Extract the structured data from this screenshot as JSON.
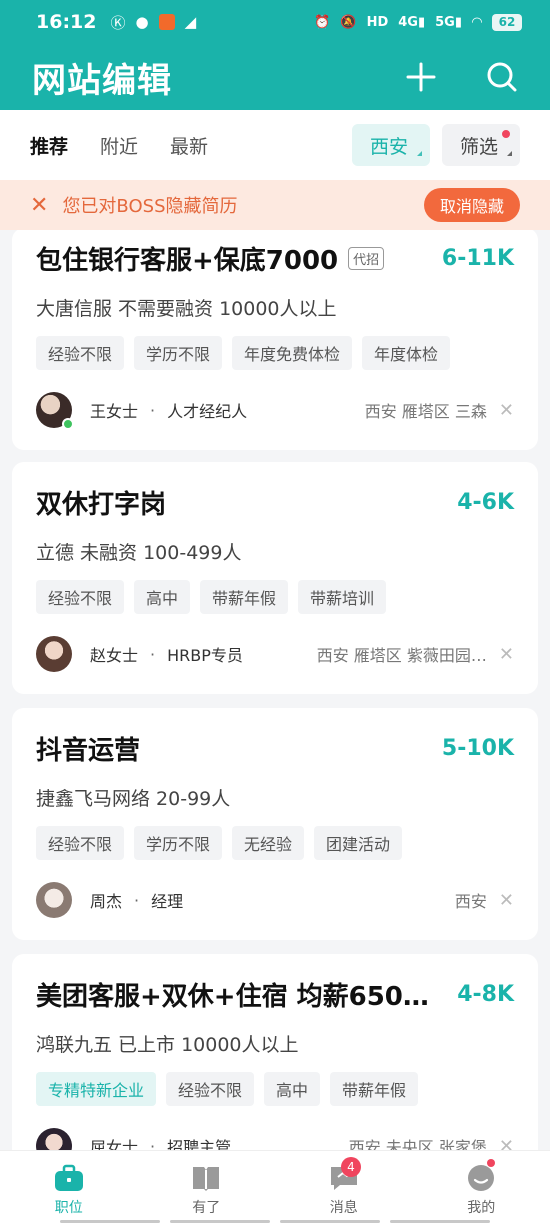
{
  "status": {
    "time": "16:12",
    "icons": [
      "k-icon",
      "chat-bubble-icon",
      "app-badge-icon",
      "send-icon"
    ],
    "right": [
      "alarm-icon",
      "mute-icon",
      "hd-icon",
      "4g-signal-icon",
      "5g-signal-icon",
      "wifi-icon"
    ],
    "battery": "62"
  },
  "header": {
    "title": "网站编辑"
  },
  "filterbar": {
    "tabs": [
      "推荐",
      "附近",
      "最新"
    ],
    "city": "西安",
    "filter": "筛选"
  },
  "notice": {
    "text": "您已对BOSS隐藏简历",
    "action": "取消隐藏"
  },
  "jobs": [
    {
      "title": "包住银行客服+保底7000",
      "agent": "代招",
      "salary": "6-11K",
      "company": "大唐信服  不需要融资  10000人以上",
      "tags": [
        "经验不限",
        "学历不限",
        "年度免费体检",
        "年度体检"
      ],
      "recruiter": "王女士",
      "role": "人才经纪人",
      "location": "西安  雁塔区  三森"
    },
    {
      "title": "双休打字岗",
      "salary": "4-6K",
      "company": "立德  未融资  100-499人",
      "tags": [
        "经验不限",
        "高中",
        "带薪年假",
        "带薪培训"
      ],
      "recruiter": "赵女士",
      "role": "HRBP专员",
      "location": "西安  雁塔区  紫薇田园…"
    },
    {
      "title": "抖音运营",
      "salary": "5-10K",
      "company": "捷鑫飞马网络  20-99人",
      "tags": [
        "经验不限",
        "学历不限",
        "无经验",
        "团建活动"
      ],
      "recruiter": "周杰",
      "role": "经理",
      "location": "西安"
    },
    {
      "title": "美团客服+双休+住宿 均薪650…",
      "salary": "4-8K",
      "company": "鸿联九五  已上市  10000人以上",
      "tags": [
        "专精特新企业",
        "经验不限",
        "高中",
        "带薪年假"
      ],
      "recruiter": "屈女士",
      "role": "招聘主管",
      "location": "西安  未央区  张家堡"
    }
  ],
  "bottomnav": {
    "items": [
      {
        "label": "职位",
        "icon": "briefcase-icon"
      },
      {
        "label": "有了",
        "icon": "book-icon"
      },
      {
        "label": "消息",
        "icon": "message-icon",
        "badge": "4"
      },
      {
        "label": "我的",
        "icon": "profile-icon"
      }
    ]
  },
  "colors": {
    "brand": "#1ab3aa",
    "notice_bg": "#fde9e0",
    "notice_text": "#e4683c",
    "badge": "#f0455e"
  }
}
